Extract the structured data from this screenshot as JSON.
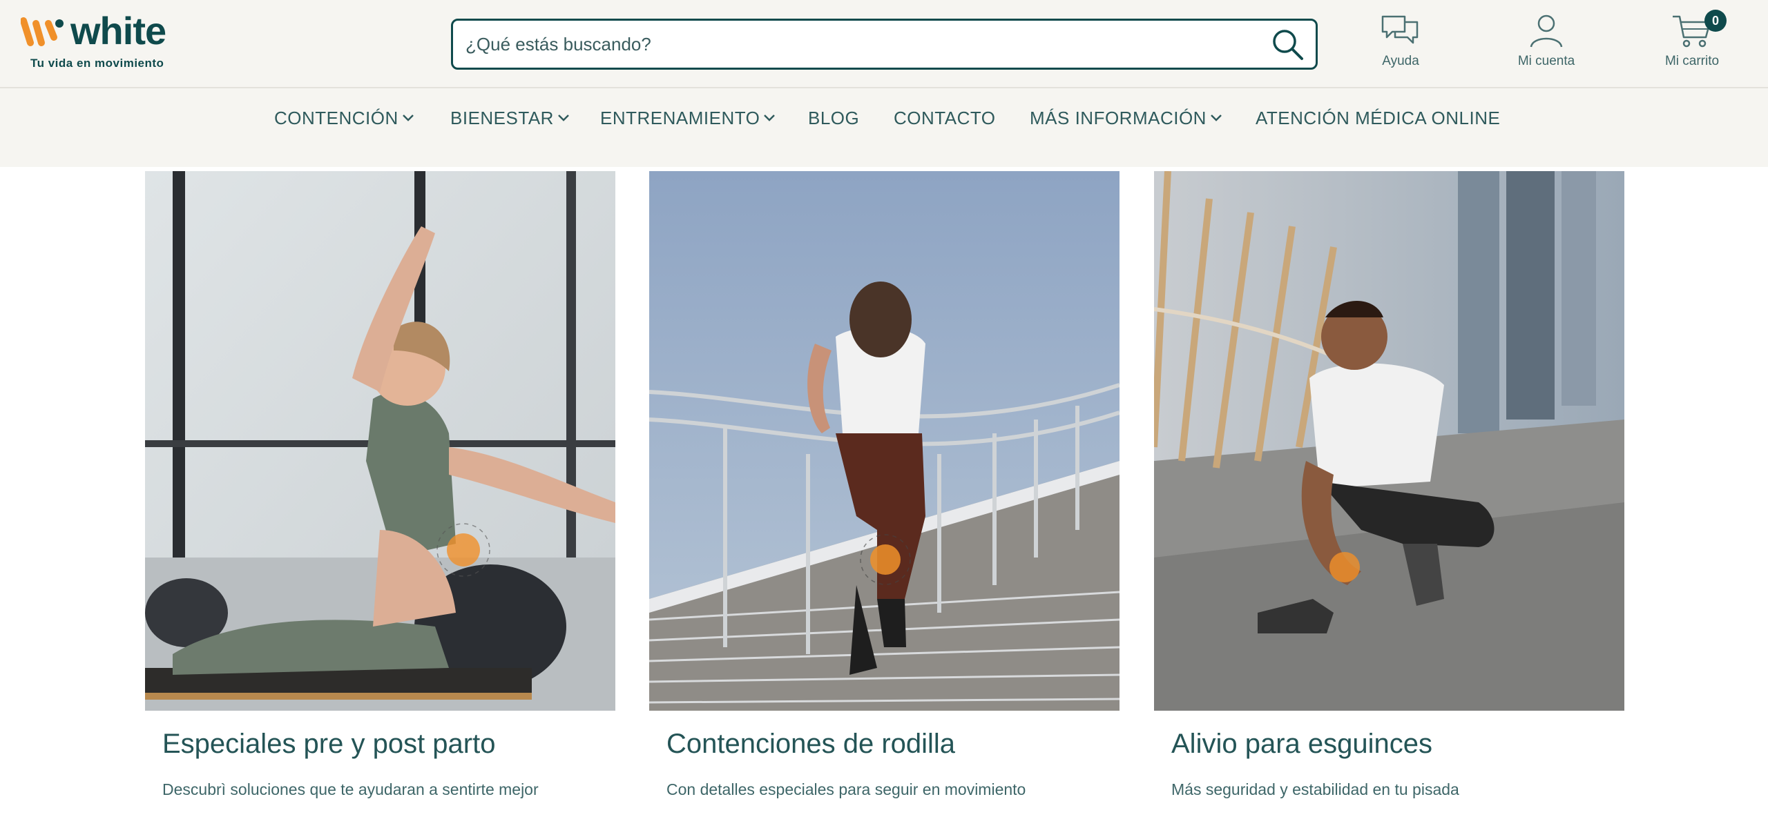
{
  "brand": {
    "name": "white",
    "tagline": "Tu vida en movimiento",
    "colors": {
      "primary": "#0f4a4c",
      "accent": "#f0902a",
      "background": "#f6f5f1"
    }
  },
  "search": {
    "placeholder": "¿Qué estás buscando?",
    "value": "",
    "icon": "search-icon"
  },
  "header_links": {
    "help": {
      "label": "Ayuda",
      "icon": "chat-bubbles-icon"
    },
    "account": {
      "label": "Mi cuenta",
      "icon": "user-icon"
    },
    "cart": {
      "label": "Mi carrito",
      "icon": "cart-icon",
      "count": "0"
    }
  },
  "nav": {
    "items": [
      {
        "label": "CONTENCIÓN",
        "has_dropdown": true
      },
      {
        "label": "BIENESTAR",
        "has_dropdown": true
      },
      {
        "label": "ENTRENAMIENTO",
        "has_dropdown": true
      },
      {
        "label": "BLOG",
        "has_dropdown": false
      },
      {
        "label": "CONTACTO",
        "has_dropdown": false
      },
      {
        "label": "MÁS INFORMACIÓN",
        "has_dropdown": true
      },
      {
        "label": "ATENCIÓN MÉDICA ONLINE",
        "has_dropdown": false
      }
    ]
  },
  "cards": [
    {
      "title": "Especiales pre y post parto",
      "description": "Descubrì soluciones que te ayudaran a sentirte mejor",
      "image": "pregnant-woman-stretching-photo"
    },
    {
      "title": "Contenciones de rodilla",
      "description": "Con detalles especiales para seguir en movimiento",
      "image": "woman-running-up-stairs-photo"
    },
    {
      "title": "Alivio para esguinces",
      "description": "Más seguridad y estabilidad en tu pisada",
      "image": "man-tying-shoe-photo"
    }
  ]
}
